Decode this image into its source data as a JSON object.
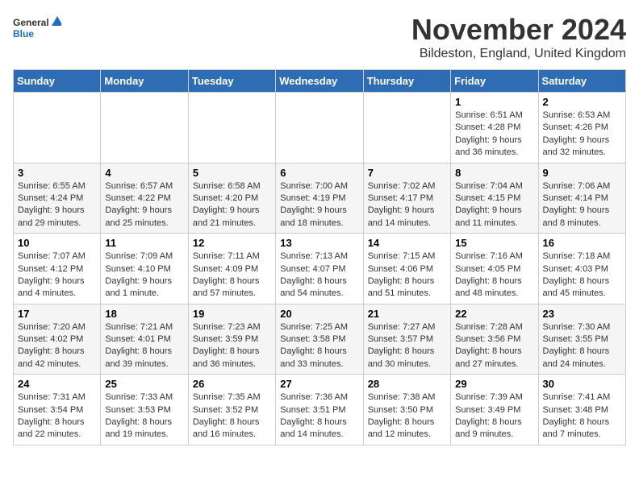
{
  "logo": {
    "general": "General",
    "blue": "Blue"
  },
  "title": "November 2024",
  "subtitle": "Bildeston, England, United Kingdom",
  "days_of_week": [
    "Sunday",
    "Monday",
    "Tuesday",
    "Wednesday",
    "Thursday",
    "Friday",
    "Saturday"
  ],
  "weeks": [
    [
      {
        "day": "",
        "info": ""
      },
      {
        "day": "",
        "info": ""
      },
      {
        "day": "",
        "info": ""
      },
      {
        "day": "",
        "info": ""
      },
      {
        "day": "",
        "info": ""
      },
      {
        "day": "1",
        "info": "Sunrise: 6:51 AM\nSunset: 4:28 PM\nDaylight: 9 hours and 36 minutes."
      },
      {
        "day": "2",
        "info": "Sunrise: 6:53 AM\nSunset: 4:26 PM\nDaylight: 9 hours and 32 minutes."
      }
    ],
    [
      {
        "day": "3",
        "info": "Sunrise: 6:55 AM\nSunset: 4:24 PM\nDaylight: 9 hours and 29 minutes."
      },
      {
        "day": "4",
        "info": "Sunrise: 6:57 AM\nSunset: 4:22 PM\nDaylight: 9 hours and 25 minutes."
      },
      {
        "day": "5",
        "info": "Sunrise: 6:58 AM\nSunset: 4:20 PM\nDaylight: 9 hours and 21 minutes."
      },
      {
        "day": "6",
        "info": "Sunrise: 7:00 AM\nSunset: 4:19 PM\nDaylight: 9 hours and 18 minutes."
      },
      {
        "day": "7",
        "info": "Sunrise: 7:02 AM\nSunset: 4:17 PM\nDaylight: 9 hours and 14 minutes."
      },
      {
        "day": "8",
        "info": "Sunrise: 7:04 AM\nSunset: 4:15 PM\nDaylight: 9 hours and 11 minutes."
      },
      {
        "day": "9",
        "info": "Sunrise: 7:06 AM\nSunset: 4:14 PM\nDaylight: 9 hours and 8 minutes."
      }
    ],
    [
      {
        "day": "10",
        "info": "Sunrise: 7:07 AM\nSunset: 4:12 PM\nDaylight: 9 hours and 4 minutes."
      },
      {
        "day": "11",
        "info": "Sunrise: 7:09 AM\nSunset: 4:10 PM\nDaylight: 9 hours and 1 minute."
      },
      {
        "day": "12",
        "info": "Sunrise: 7:11 AM\nSunset: 4:09 PM\nDaylight: 8 hours and 57 minutes."
      },
      {
        "day": "13",
        "info": "Sunrise: 7:13 AM\nSunset: 4:07 PM\nDaylight: 8 hours and 54 minutes."
      },
      {
        "day": "14",
        "info": "Sunrise: 7:15 AM\nSunset: 4:06 PM\nDaylight: 8 hours and 51 minutes."
      },
      {
        "day": "15",
        "info": "Sunrise: 7:16 AM\nSunset: 4:05 PM\nDaylight: 8 hours and 48 minutes."
      },
      {
        "day": "16",
        "info": "Sunrise: 7:18 AM\nSunset: 4:03 PM\nDaylight: 8 hours and 45 minutes."
      }
    ],
    [
      {
        "day": "17",
        "info": "Sunrise: 7:20 AM\nSunset: 4:02 PM\nDaylight: 8 hours and 42 minutes."
      },
      {
        "day": "18",
        "info": "Sunrise: 7:21 AM\nSunset: 4:01 PM\nDaylight: 8 hours and 39 minutes."
      },
      {
        "day": "19",
        "info": "Sunrise: 7:23 AM\nSunset: 3:59 PM\nDaylight: 8 hours and 36 minutes."
      },
      {
        "day": "20",
        "info": "Sunrise: 7:25 AM\nSunset: 3:58 PM\nDaylight: 8 hours and 33 minutes."
      },
      {
        "day": "21",
        "info": "Sunrise: 7:27 AM\nSunset: 3:57 PM\nDaylight: 8 hours and 30 minutes."
      },
      {
        "day": "22",
        "info": "Sunrise: 7:28 AM\nSunset: 3:56 PM\nDaylight: 8 hours and 27 minutes."
      },
      {
        "day": "23",
        "info": "Sunrise: 7:30 AM\nSunset: 3:55 PM\nDaylight: 8 hours and 24 minutes."
      }
    ],
    [
      {
        "day": "24",
        "info": "Sunrise: 7:31 AM\nSunset: 3:54 PM\nDaylight: 8 hours and 22 minutes."
      },
      {
        "day": "25",
        "info": "Sunrise: 7:33 AM\nSunset: 3:53 PM\nDaylight: 8 hours and 19 minutes."
      },
      {
        "day": "26",
        "info": "Sunrise: 7:35 AM\nSunset: 3:52 PM\nDaylight: 8 hours and 16 minutes."
      },
      {
        "day": "27",
        "info": "Sunrise: 7:36 AM\nSunset: 3:51 PM\nDaylight: 8 hours and 14 minutes."
      },
      {
        "day": "28",
        "info": "Sunrise: 7:38 AM\nSunset: 3:50 PM\nDaylight: 8 hours and 12 minutes."
      },
      {
        "day": "29",
        "info": "Sunrise: 7:39 AM\nSunset: 3:49 PM\nDaylight: 8 hours and 9 minutes."
      },
      {
        "day": "30",
        "info": "Sunrise: 7:41 AM\nSunset: 3:48 PM\nDaylight: 8 hours and 7 minutes."
      }
    ]
  ]
}
